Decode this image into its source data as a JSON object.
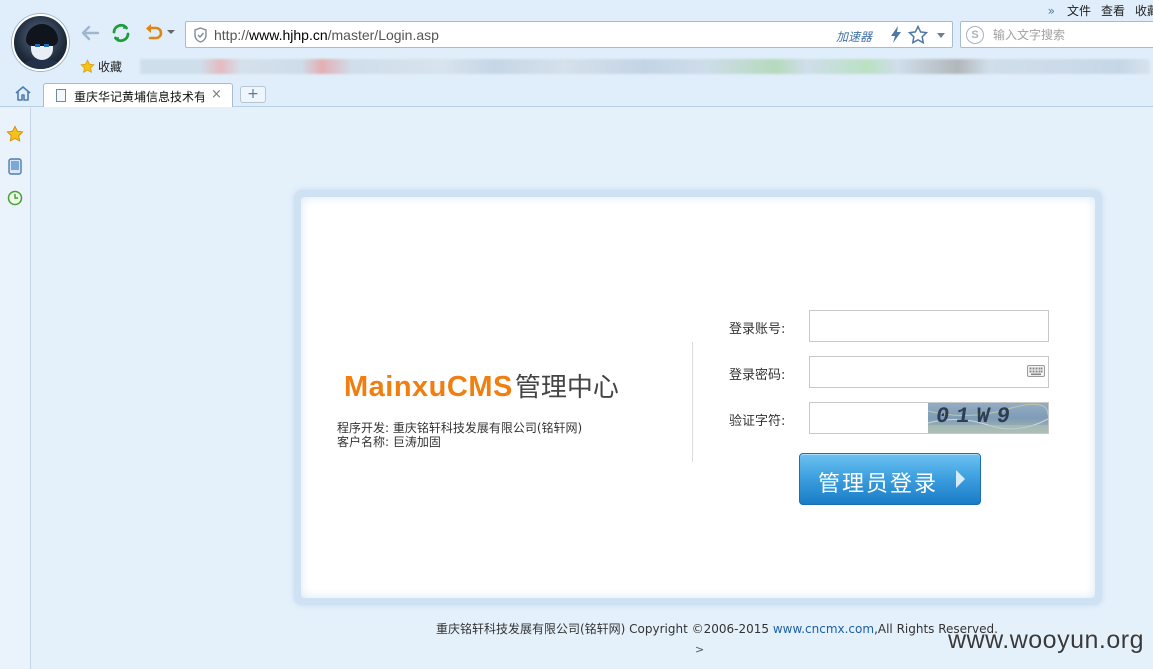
{
  "browser": {
    "url_prefix": "http://",
    "url_domain": "www.hjhp.cn",
    "url_path": "/master/Login.asp",
    "accelerator_label": "加速器",
    "search_placeholder": "输入文字搜索",
    "search_logo": "S",
    "menu": [
      "文件",
      "查看",
      "收藏"
    ],
    "menu_chevron": "»",
    "favorites_label": "收藏",
    "tab_title": "重庆华记黄埔信息技术有限公司",
    "tab_close": "×",
    "new_tab": "+"
  },
  "login": {
    "brand_en": "MainxuCMS",
    "brand_cn": "管理中心",
    "developer_line": "程序开发: 重庆铭轩科技发展有限公司(铭轩网)",
    "client_line": "客户名称: 巨涛加固",
    "account_label": "登录账号:",
    "password_label": "登录密码:",
    "captcha_label": "验证字符:",
    "captcha_text": "01W9",
    "login_button": "管理员登录"
  },
  "footer": {
    "text_before": "重庆铭轩科技发展有限公司(铭轩网) Copyright ©2006-2015 ",
    "link": "www.cncmx.com",
    "text_after": ",All Rights Reserved.",
    "arrow": ">"
  },
  "watermark": "www.wooyun.org",
  "colors": {
    "brand_orange": "#f07f10",
    "button_blue": "#3fa1e0",
    "link_blue": "#1b5fa8",
    "page_bg": "#e4f1fb"
  },
  "icons": {
    "back": "back-arrow-icon",
    "refresh": "refresh-icon",
    "undo": "undo-icon",
    "security": "shield-icon",
    "accelerate": "lightning-icon",
    "bookmark": "star-icon",
    "home": "home-icon",
    "keyboard": "keyboard-icon"
  }
}
